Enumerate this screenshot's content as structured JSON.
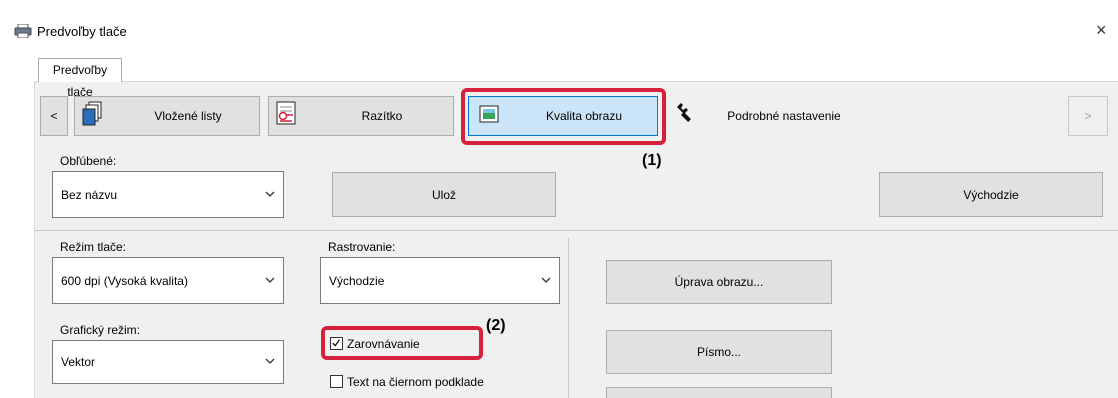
{
  "window": {
    "title": "Predvoľby tlače",
    "close_glyph": "×"
  },
  "tab": {
    "label": "Predvoľby tlače"
  },
  "toolbar": {
    "prev_glyph": "<",
    "next_glyph": ">",
    "items": [
      {
        "label": "Vložené listy",
        "icon": "inserted-sheets-icon"
      },
      {
        "label": "Razítko",
        "icon": "stamp-icon"
      },
      {
        "label": "Kvalita obrazu",
        "icon": "image-quality-icon",
        "active": true
      },
      {
        "label": "Podrobné nastavenie",
        "icon": "wrench-icon"
      }
    ]
  },
  "annotations": {
    "callout_1": "(1)",
    "callout_2": "(2)",
    "highlight_color": "#d6213d"
  },
  "favorites": {
    "label": "Obľúbené:",
    "value": "Bez názvu",
    "save_label": "Ulož",
    "default_label": "Východzie"
  },
  "print_mode": {
    "label": "Režim tlače:",
    "value": "600 dpi (Vysoká kvalita)"
  },
  "dithering": {
    "label": "Rastrovanie:",
    "value": "Východzie"
  },
  "graphics_mode": {
    "label": "Grafický režim:",
    "value": "Vektor"
  },
  "checkboxes": {
    "smoothing": {
      "label": "Zarovnávanie",
      "checked": true
    },
    "text_black_bg": {
      "label": "Text na čiernom podklade",
      "checked": false
    }
  },
  "buttons": {
    "image_adjust": "Úprava obrazu...",
    "font": "Písmo..."
  }
}
